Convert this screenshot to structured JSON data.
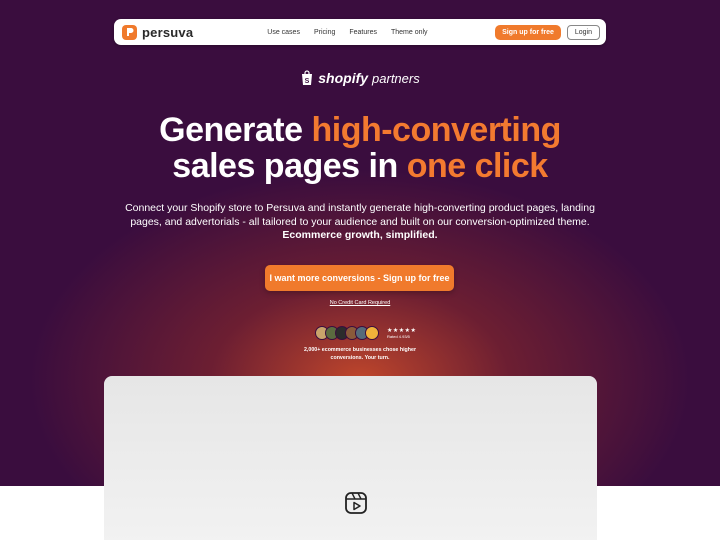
{
  "nav": {
    "brand": "persuva",
    "links": [
      "Use cases",
      "Pricing",
      "Features",
      "Theme only"
    ],
    "signup": "Sign up for free",
    "login": "Login"
  },
  "partner": {
    "brand": "shopify",
    "suffix": "partners"
  },
  "hero": {
    "line1_plain": "Generate ",
    "line1_accent": "high-converting",
    "line2_plain": "sales pages in ",
    "line2_accent": "one click",
    "subtext": "Connect your Shopify store to Persuva and instantly generate high-converting product pages, landing pages, and advertorials - all tailored to your audience and built on our conversion-optimized theme.",
    "subtext_bold": "Ecommerce growth, simplified.",
    "cta": "I want more conversions - Sign up for free",
    "no_credit_card": "No Credit Card Required"
  },
  "social_proof": {
    "stars": "★★★★★",
    "rated": "Rated 4.93/5",
    "text": "2,000+ ecommerce businesses chose higher conversions. Your turn.",
    "avatar_colors": [
      "#c9a46b",
      "#5b6b3f",
      "#2c2c2c",
      "#8a5a3a",
      "#556b7a",
      "#f0b23a"
    ]
  },
  "colors": {
    "accent": "#f07a2c",
    "hero_bg": "#3a0d3e"
  },
  "icons": {
    "play": "play-reel-icon",
    "logo": "persuva-logo-icon",
    "bag": "shopify-bag-icon"
  }
}
